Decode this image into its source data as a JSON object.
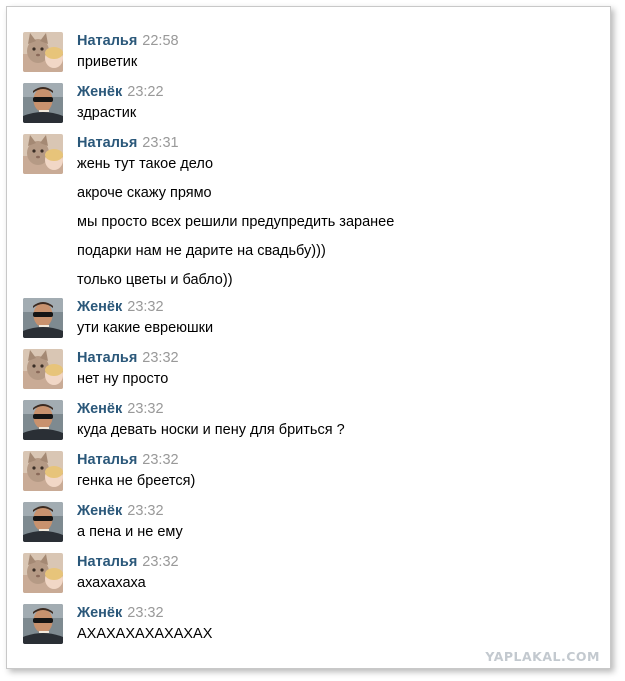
{
  "colors": {
    "author": "#2b587a",
    "time": "#999999",
    "text": "#000000",
    "watermark": "#c3c9cf"
  },
  "messages": [
    {
      "author": "Наталья",
      "avatar": "cat-avatar",
      "time": "22:58",
      "lines": [
        "приветик"
      ]
    },
    {
      "author": "Женёк",
      "avatar": "man-avatar",
      "time": "23:22",
      "lines": [
        "здрастик"
      ]
    },
    {
      "author": "Наталья",
      "avatar": "cat-avatar",
      "time": "23:31",
      "lines": [
        "жень тут такое дело",
        "акроче скажу прямо",
        "мы просто всех решили предупредить заранее",
        "подарки нам не дарите на свадьбу)))",
        "только цветы и бабло))"
      ]
    },
    {
      "author": "Женёк",
      "avatar": "man-avatar",
      "time": "23:32",
      "lines": [
        "ути какие евреюшки"
      ]
    },
    {
      "author": "Наталья",
      "avatar": "cat-avatar",
      "time": "23:32",
      "lines": [
        "нет ну просто"
      ]
    },
    {
      "author": "Женёк",
      "avatar": "man-avatar",
      "time": "23:32",
      "lines": [
        "куда девать носки и пену для бриться ?"
      ]
    },
    {
      "author": "Наталья",
      "avatar": "cat-avatar",
      "time": "23:32",
      "lines": [
        "генка не бреется)"
      ]
    },
    {
      "author": "Женёк",
      "avatar": "man-avatar",
      "time": "23:32",
      "lines": [
        "а пена и не ему"
      ]
    },
    {
      "author": "Наталья",
      "avatar": "cat-avatar",
      "time": "23:32",
      "lines": [
        "ахахахаха"
      ]
    },
    {
      "author": "Женёк",
      "avatar": "man-avatar",
      "time": "23:32",
      "lines": [
        "АХАХАХАХАХАХАХ"
      ]
    }
  ],
  "watermark": "YAPLAKAL.COM"
}
